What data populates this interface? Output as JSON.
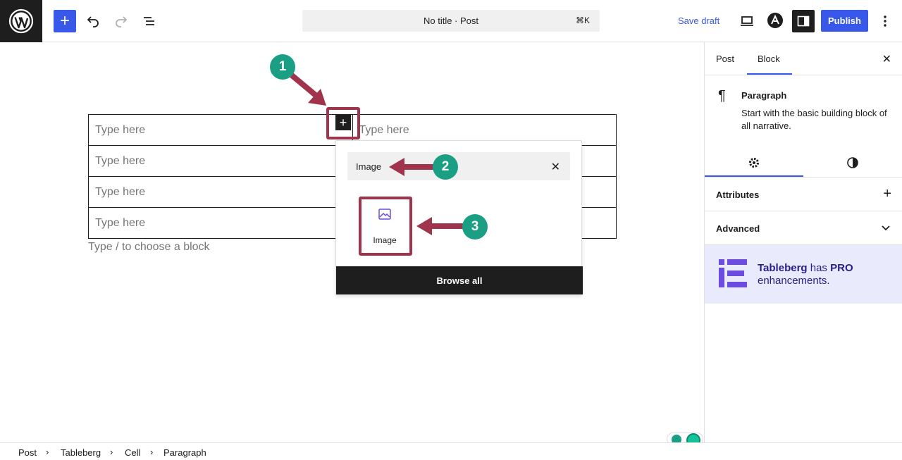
{
  "header": {
    "document_title": "No title · Post",
    "shortcut": "⌘K",
    "save_draft": "Save draft",
    "publish": "Publish"
  },
  "editor": {
    "table_cells": [
      [
        "Type here",
        "Type here"
      ],
      [
        "Type here",
        ""
      ],
      [
        "Type here",
        ""
      ],
      [
        "Type here",
        ""
      ]
    ],
    "block_hint": "Type / to choose a block"
  },
  "inserter": {
    "search_value": "Image",
    "result_label": "Image",
    "browse_all": "Browse all"
  },
  "annotations": {
    "step1": "1",
    "step2": "2",
    "step3": "3",
    "color": "#a0344d",
    "badge_color": "#1a9e84"
  },
  "sidebar": {
    "tabs": [
      "Post",
      "Block"
    ],
    "block_name": "Paragraph",
    "block_description": "Start with the basic building block of all narrative.",
    "panels": [
      "Attributes",
      "Advanced"
    ],
    "promo_brand": "Tableberg",
    "promo_has": " has ",
    "promo_pro": "PRO",
    "promo_rest": "enhancements."
  },
  "breadcrumb": [
    "Post",
    "Tableberg",
    "Cell",
    "Paragraph"
  ],
  "colors": {
    "accent": "#3858e9",
    "dark": "#1e1e1e",
    "promo_bg": "#eaeafd",
    "promo_purple": "#6b4be0"
  }
}
